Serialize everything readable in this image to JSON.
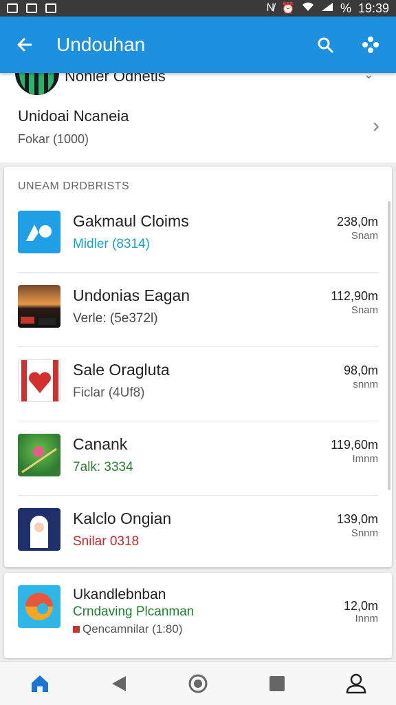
{
  "status_bar": {
    "time": "19:39",
    "battery": "%",
    "icons": [
      "image-icon",
      "sync-icon",
      "photo-icon",
      "nfc-icon",
      "alarm-icon",
      "wifi-icon",
      "signal-icon"
    ]
  },
  "app_bar": {
    "title": "Undouhan",
    "back_icon": "back-arrow-icon",
    "actions": [
      "search-icon",
      "apps-icon"
    ]
  },
  "top_card": {
    "partial_title": "Nonier  Odnetis",
    "nav_title": "Unidoai Ncaneia",
    "nav_subtitle": "Fokar (1000)"
  },
  "section": {
    "header": "UNEAM DRDBRISTS",
    "apps": [
      {
        "name": "Gakmaul Cloims",
        "sub": "Midler (8314)",
        "sub_color": "#17a2c8",
        "size": "238,0m",
        "unit": "Snam"
      },
      {
        "name": "Undonias Eagan",
        "sub": "Verle: (5e372l)",
        "sub_color": "#444444",
        "size": "112,90m",
        "unit": "Snam"
      },
      {
        "name": "Sale Oragluta",
        "sub": "Ficlar (4Uf8)",
        "sub_color": "#555555",
        "size": "98,0m",
        "unit": "snnm"
      },
      {
        "name": "Canank",
        "sub": "7alk: 3334",
        "sub_color": "#2e7d32",
        "size": "119,60m",
        "unit": "Imnm"
      },
      {
        "name": "Kalclo Ongian",
        "sub": "Snilar 0318",
        "sub_color": "#c62828",
        "size": "139,0m",
        "unit": "Snnm"
      }
    ]
  },
  "lower_card": {
    "name": "Ukandlebnban",
    "sub1": "Crndaving Plcanman",
    "sub2": "Qencamnilar (1:80)",
    "size": "12,0m",
    "unit": "Innm"
  },
  "bottom_nav": [
    "home-icon",
    "back-triangle-icon",
    "record-icon",
    "square-icon",
    "profile-icon"
  ],
  "colors": {
    "accent": "#1e90e0",
    "status_bar": "#3a3a3a"
  }
}
